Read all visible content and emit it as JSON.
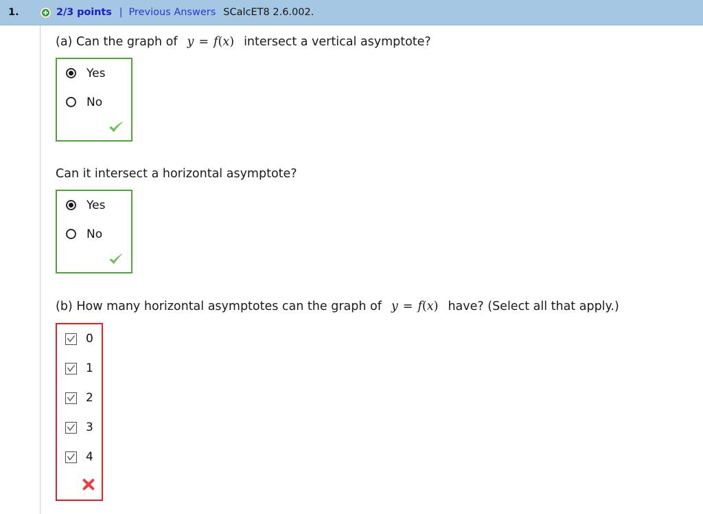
{
  "header": {
    "question_number": "1.",
    "status_icon": "plus-circle-icon",
    "points": "2/3 points",
    "separator": "|",
    "previous_answers_label": "Previous Answers",
    "question_code": "SCalcET8 2.6.002.",
    "bar_color": "#a6c7e3",
    "points_color": "#1c1ccc",
    "link_color": "#2c35d6"
  },
  "parts": [
    {
      "id": "part-a-vertical",
      "prompt_prefix": "(a) Can the graph of",
      "math_y": "y",
      "math_eq": "=",
      "math_f": "f",
      "math_paren_open": "(",
      "math_x": "x",
      "math_paren_close": ")",
      "prompt_suffix": "intersect a vertical asymptote?",
      "options": [
        {
          "label": "Yes",
          "selected": true
        },
        {
          "label": "No",
          "selected": false
        }
      ],
      "verdict": "correct",
      "verdict_icon": "green-check-icon",
      "border_color": "#54a13c"
    },
    {
      "id": "part-a-horizontal",
      "prompt_prefix": "Can it intersect a horizontal asymptote?",
      "prompt_suffix": "",
      "options": [
        {
          "label": "Yes",
          "selected": true
        },
        {
          "label": "No",
          "selected": false
        }
      ],
      "verdict": "correct",
      "verdict_icon": "green-check-icon",
      "border_color": "#54a13c"
    }
  ],
  "part_b": {
    "id": "part-b",
    "prompt_prefix": "(b) How many horizontal asymptotes can the graph of",
    "math_y": "y",
    "math_eq": "=",
    "math_f": "f",
    "math_paren_open": "(",
    "math_x": "x",
    "math_paren_close": ")",
    "prompt_suffix": "have? (Select all that apply.)",
    "options": [
      {
        "label": "0",
        "checked": true
      },
      {
        "label": "1",
        "checked": true
      },
      {
        "label": "2",
        "checked": true
      },
      {
        "label": "3",
        "checked": true
      },
      {
        "label": "4",
        "checked": true
      }
    ],
    "verdict": "incorrect",
    "verdict_icon": "red-x-icon",
    "border_color": "#ee1c25"
  }
}
